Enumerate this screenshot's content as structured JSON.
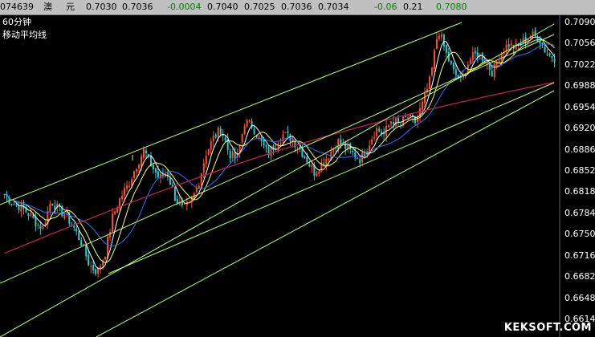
{
  "topbar": {
    "code": "074639",
    "name_1": "澳",
    "name_2": "元",
    "price_a": "0.7030",
    "price_b": "0.7036",
    "change_1": "-0.0004",
    "price_c": "0.7040",
    "price_d": "0.7025",
    "price_e": "0.7036",
    "price_f": "0.7034",
    "change_2": "-0.06",
    "value_g": "0.21",
    "price_h": "0.7080",
    "text_color": "#000000",
    "change_color": "#008000"
  },
  "period_label": "60分钟",
  "indicator_label": "移动平均线",
  "watermark": "KEKSOFT.COM",
  "colors": {
    "bg": "#000000",
    "up": "#ff5020",
    "down": "#20d0d0",
    "trendline": "#c0ff60",
    "ma_white": "#ffffff",
    "ma_yellow": "#ffff60",
    "ma_blue": "#3070ff",
    "ma_red": "#c02050"
  },
  "chart_data": {
    "type": "candlestick",
    "ylim": [
      0.6614,
      0.7105
    ],
    "ytick_labels": [
      "0.7090",
      "0.7056",
      "0.7022",
      "0.6988",
      "0.6954",
      "0.6920",
      "0.6886",
      "0.6852",
      "0.6818",
      "0.6784",
      "0.6750",
      "0.6716",
      "0.6682",
      "0.6648",
      "0.6614"
    ],
    "close_path": [
      0.6815,
      0.68,
      0.6795,
      0.6785,
      0.677,
      0.676,
      0.6805,
      0.679,
      0.678,
      0.676,
      0.6735,
      0.67,
      0.669,
      0.672,
      0.678,
      0.681,
      0.683,
      0.686,
      0.6885,
      0.686,
      0.684,
      0.685,
      0.681,
      0.679,
      0.68,
      0.683,
      0.688,
      0.6905,
      0.692,
      0.688,
      0.687,
      0.693,
      0.6925,
      0.69,
      0.688,
      0.6895,
      0.691,
      0.6905,
      0.689,
      0.687,
      0.685,
      0.6865,
      0.688,
      0.69,
      0.689,
      0.688,
      0.687,
      0.6895,
      0.692,
      0.691,
      0.6935,
      0.6925,
      0.694,
      0.693,
      0.696,
      0.7,
      0.708,
      0.704,
      0.701,
      0.6995,
      0.703,
      0.704,
      0.703,
      0.701,
      0.704,
      0.7055,
      0.705,
      0.706,
      0.707,
      0.7065,
      0.704,
      0.7034
    ],
    "moving_average_lines": 4,
    "trend_lines": 6
  }
}
